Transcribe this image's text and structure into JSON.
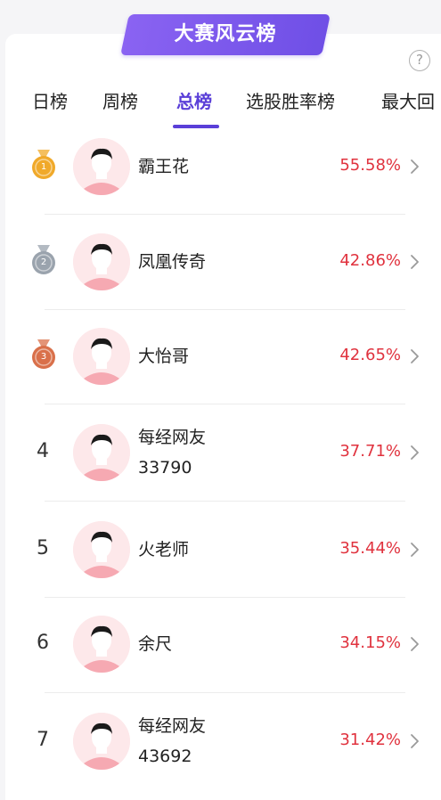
{
  "header": {
    "title": "大赛风云榜",
    "help_icon_glyph": "?"
  },
  "tabs": [
    {
      "label": "日榜",
      "active": false
    },
    {
      "label": "周榜",
      "active": false
    },
    {
      "label": "总榜",
      "active": true
    },
    {
      "label": "选股胜率榜",
      "active": false
    },
    {
      "label": "最大回",
      "active": false
    }
  ],
  "rankings": [
    {
      "rank": "1",
      "medal": "gold",
      "name": "霸王花",
      "name_line2": "",
      "rate": "55.58%"
    },
    {
      "rank": "2",
      "medal": "silver",
      "name": "凤凰传奇",
      "name_line2": "",
      "rate": "42.86%"
    },
    {
      "rank": "3",
      "medal": "bronze",
      "name": "大怡哥",
      "name_line2": "",
      "rate": "42.65%"
    },
    {
      "rank": "4",
      "medal": "",
      "name": "每经网友",
      "name_line2": "33790",
      "rate": "37.71%"
    },
    {
      "rank": "5",
      "medal": "",
      "name": "火老师",
      "name_line2": "",
      "rate": "35.44%"
    },
    {
      "rank": "6",
      "medal": "",
      "name": "余尺",
      "name_line2": "",
      "rate": "34.15%"
    },
    {
      "rank": "7",
      "medal": "",
      "name": "每经网友",
      "name_line2": "43692",
      "rate": "31.42%"
    }
  ],
  "colors": {
    "accent": "#5a3fd8",
    "rate": "#e0323e",
    "gold": "#f0a92a",
    "silver": "#9aa3ad",
    "bronze": "#d9704a"
  }
}
